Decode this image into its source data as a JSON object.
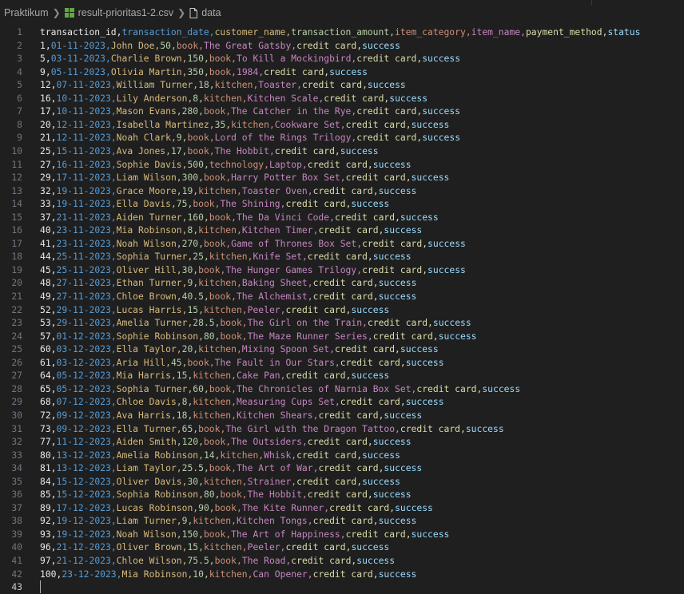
{
  "breadcrumb": {
    "folder": "Praktikum",
    "file": "result-prioritas1-2.csv",
    "symbol": "data",
    "icons": [
      "chevron-right-icon",
      "csv-file-icon",
      "file-icon"
    ]
  },
  "rainbow_colors": [
    "#e8e8e8",
    "#569cd6",
    "#d7ba7d",
    "#b5cea8",
    "#ce9178",
    "#c586c0",
    "#dcdcaa",
    "#9cdcfe",
    "#4ec9b0"
  ],
  "lines": [
    {
      "num": "1",
      "cells": [
        "transaction_id",
        "transaction_date",
        "customer_name",
        "transaction_amount",
        "item_category",
        "item_name",
        "payment_method",
        "status"
      ]
    },
    {
      "num": "2",
      "cells": [
        "1",
        "01-11-2023",
        "John Doe",
        "50",
        "book",
        "The Great Gatsby",
        "credit card",
        "success"
      ]
    },
    {
      "num": "3",
      "cells": [
        "5",
        "03-11-2023",
        "Charlie Brown",
        "150",
        "book",
        "To Kill a Mockingbird",
        "credit card",
        "success"
      ]
    },
    {
      "num": "4",
      "cells": [
        "9",
        "05-11-2023",
        "Olivia Martin",
        "350",
        "book",
        "1984",
        "credit card",
        "success"
      ]
    },
    {
      "num": "5",
      "cells": [
        "12",
        "07-11-2023",
        "William Turner",
        "18",
        "kitchen",
        "Toaster",
        "credit card",
        "success"
      ]
    },
    {
      "num": "6",
      "cells": [
        "16",
        "10-11-2023",
        "Lily Anderson",
        "8",
        "kitchen",
        "Kitchen Scale",
        "credit card",
        "success"
      ]
    },
    {
      "num": "7",
      "cells": [
        "17",
        "10-11-2023",
        "Mason Evans",
        "280",
        "book",
        "The Catcher in the Rye",
        "credit card",
        "success"
      ]
    },
    {
      "num": "8",
      "cells": [
        "20",
        "12-11-2023",
        "Isabella Martinez",
        "35",
        "kitchen",
        "Cookware Set",
        "credit card",
        "success"
      ]
    },
    {
      "num": "9",
      "cells": [
        "21",
        "12-11-2023",
        "Noah Clark",
        "9",
        "book",
        "Lord of the Rings Trilogy",
        "credit card",
        "success"
      ]
    },
    {
      "num": "10",
      "cells": [
        "25",
        "15-11-2023",
        "Ava Jones",
        "17",
        "book",
        "The Hobbit",
        "credit card",
        "success"
      ]
    },
    {
      "num": "11",
      "cells": [
        "27",
        "16-11-2023",
        "Sophie Davis",
        "500",
        "technology",
        "Laptop",
        "credit card",
        "success"
      ]
    },
    {
      "num": "12",
      "cells": [
        "29",
        "17-11-2023",
        "Liam Wilson",
        "300",
        "book",
        "Harry Potter Box Set",
        "credit card",
        "success"
      ]
    },
    {
      "num": "13",
      "cells": [
        "32",
        "19-11-2023",
        "Grace Moore",
        "19",
        "kitchen",
        "Toaster Oven",
        "credit card",
        "success"
      ]
    },
    {
      "num": "14",
      "cells": [
        "33",
        "19-11-2023",
        "Ella Davis",
        "75",
        "book",
        "The Shining",
        "credit card",
        "success"
      ]
    },
    {
      "num": "15",
      "cells": [
        "37",
        "21-11-2023",
        "Aiden Turner",
        "160",
        "book",
        "The Da Vinci Code",
        "credit card",
        "success"
      ]
    },
    {
      "num": "16",
      "cells": [
        "40",
        "23-11-2023",
        "Mia Robinson",
        "8",
        "kitchen",
        "Kitchen Timer",
        "credit card",
        "success"
      ]
    },
    {
      "num": "17",
      "cells": [
        "41",
        "23-11-2023",
        "Noah Wilson",
        "270",
        "book",
        "Game of Thrones Box Set",
        "credit card",
        "success"
      ]
    },
    {
      "num": "18",
      "cells": [
        "44",
        "25-11-2023",
        "Sophia Turner",
        "25",
        "kitchen",
        "Knife Set",
        "credit card",
        "success"
      ]
    },
    {
      "num": "19",
      "cells": [
        "45",
        "25-11-2023",
        "Oliver Hill",
        "30",
        "book",
        "The Hunger Games Trilogy",
        "credit card",
        "success"
      ]
    },
    {
      "num": "20",
      "cells": [
        "48",
        "27-11-2023",
        "Ethan Turner",
        "9",
        "kitchen",
        "Baking Sheet",
        "credit card",
        "success"
      ]
    },
    {
      "num": "21",
      "cells": [
        "49",
        "27-11-2023",
        "Chloe Brown",
        "40.5",
        "book",
        "The Alchemist",
        "credit card",
        "success"
      ]
    },
    {
      "num": "22",
      "cells": [
        "52",
        "29-11-2023",
        "Lucas Harris",
        "15",
        "kitchen",
        "Peeler",
        "credit card",
        "success"
      ]
    },
    {
      "num": "23",
      "cells": [
        "53",
        "29-11-2023",
        "Amelia Turner",
        "28.5",
        "book",
        "The Girl on the Train",
        "credit card",
        "success"
      ]
    },
    {
      "num": "24",
      "cells": [
        "57",
        "01-12-2023",
        "Sophie Robinson",
        "80",
        "book",
        "The Maze Runner Series",
        "credit card",
        "success"
      ]
    },
    {
      "num": "25",
      "cells": [
        "60",
        "03-12-2023",
        "Ella Taylor",
        "20",
        "kitchen",
        "Mixing Spoon Set",
        "credit card",
        "success"
      ]
    },
    {
      "num": "26",
      "cells": [
        "61",
        "03-12-2023",
        "Aria Hill",
        "45",
        "book",
        "The Fault in Our Stars",
        "credit card",
        "success"
      ]
    },
    {
      "num": "27",
      "cells": [
        "64",
        "05-12-2023",
        "Mia Harris",
        "15",
        "kitchen",
        "Cake Pan",
        "credit card",
        "success"
      ]
    },
    {
      "num": "28",
      "cells": [
        "65",
        "05-12-2023",
        "Sophia Turner",
        "60",
        "book",
        "The Chronicles of Narnia Box Set",
        "credit card",
        "success"
      ]
    },
    {
      "num": "29",
      "cells": [
        "68",
        "07-12-2023",
        "Chloe Davis",
        "8",
        "kitchen",
        "Measuring Cups Set",
        "credit card",
        "success"
      ]
    },
    {
      "num": "30",
      "cells": [
        "72",
        "09-12-2023",
        "Ava Harris",
        "18",
        "kitchen",
        "Kitchen Shears",
        "credit card",
        "success"
      ]
    },
    {
      "num": "31",
      "cells": [
        "73",
        "09-12-2023",
        "Ella Turner",
        "65",
        "book",
        "The Girl with the Dragon Tattoo",
        "credit card",
        "success"
      ]
    },
    {
      "num": "32",
      "cells": [
        "77",
        "11-12-2023",
        "Aiden Smith",
        "120",
        "book",
        "The Outsiders",
        "credit card",
        "success"
      ]
    },
    {
      "num": "33",
      "cells": [
        "80",
        "13-12-2023",
        "Amelia Robinson",
        "14",
        "kitchen",
        "Whisk",
        "credit card",
        "success"
      ]
    },
    {
      "num": "34",
      "cells": [
        "81",
        "13-12-2023",
        "Liam Taylor",
        "25.5",
        "book",
        "The Art of War",
        "credit card",
        "success"
      ]
    },
    {
      "num": "35",
      "cells": [
        "84",
        "15-12-2023",
        "Oliver Davis",
        "30",
        "kitchen",
        "Strainer",
        "credit card",
        "success"
      ]
    },
    {
      "num": "36",
      "cells": [
        "85",
        "15-12-2023",
        "Sophia Robinson",
        "80",
        "book",
        "The Hobbit",
        "credit card",
        "success"
      ]
    },
    {
      "num": "37",
      "cells": [
        "89",
        "17-12-2023",
        "Lucas Robinson",
        "90",
        "book",
        "The Kite Runner",
        "credit card",
        "success"
      ]
    },
    {
      "num": "38",
      "cells": [
        "92",
        "19-12-2023",
        "Liam Turner",
        "9",
        "kitchen",
        "Kitchen Tongs",
        "credit card",
        "success"
      ]
    },
    {
      "num": "39",
      "cells": [
        "93",
        "19-12-2023",
        "Noah Wilson",
        "150",
        "book",
        "The Art of Happiness",
        "credit card",
        "success"
      ]
    },
    {
      "num": "40",
      "cells": [
        "96",
        "21-12-2023",
        "Oliver Brown",
        "15",
        "kitchen",
        "Peeler",
        "credit card",
        "success"
      ]
    },
    {
      "num": "41",
      "cells": [
        "97",
        "21-12-2023",
        "Chloe Wilson",
        "75.5",
        "book",
        "The Road",
        "credit card",
        "success"
      ]
    },
    {
      "num": "42",
      "cells": [
        "100",
        "23-12-2023",
        "Mia Robinson",
        "10",
        "kitchen",
        "Can Opener",
        "credit card",
        "success"
      ]
    },
    {
      "num": "43",
      "cells": []
    }
  ],
  "active_line": "43"
}
